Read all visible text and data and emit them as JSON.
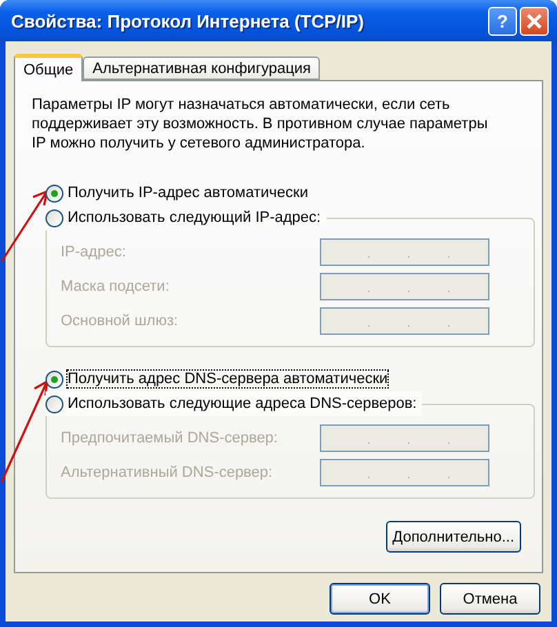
{
  "window": {
    "title": "Свойства: Протокол Интернета (TCP/IP)",
    "help_button": "?"
  },
  "tabs": [
    {
      "label": "Общие",
      "selected": true
    },
    {
      "label": "Альтернативная конфигурация",
      "selected": false
    }
  ],
  "description": "Параметры IP могут назначаться автоматически, если сеть поддерживает эту возможность. В противном случае параметры IP можно получить у сетевого администратора.",
  "ip_section": {
    "options": [
      {
        "label": "Получить IP-адрес автоматически",
        "selected": true,
        "focused": false
      },
      {
        "label": "Использовать следующий IP-адрес:",
        "selected": false,
        "focused": false
      }
    ],
    "fields": [
      {
        "label": "IP-адрес:",
        "disabled": true,
        "separator": "."
      },
      {
        "label": "Маска подсети:",
        "disabled": true,
        "separator": "."
      },
      {
        "label": "Основной шлюз:",
        "disabled": true,
        "separator": "."
      }
    ]
  },
  "dns_section": {
    "options": [
      {
        "label": "Получить адрес DNS-сервера автоматически",
        "selected": true,
        "focused": true
      },
      {
        "label": "Использовать следующие адреса DNS-серверов:",
        "selected": false,
        "focused": false
      }
    ],
    "fields": [
      {
        "label": "Предпочитаемый DNS-сервер:",
        "disabled": true,
        "separator": "."
      },
      {
        "label": "Альтернативный DNS-сервер:",
        "disabled": true,
        "separator": "."
      }
    ]
  },
  "advanced_button": "Дополнительно...",
  "buttons": [
    {
      "label": "OK",
      "default": true
    },
    {
      "label": "Отмена",
      "default": false
    }
  ]
}
